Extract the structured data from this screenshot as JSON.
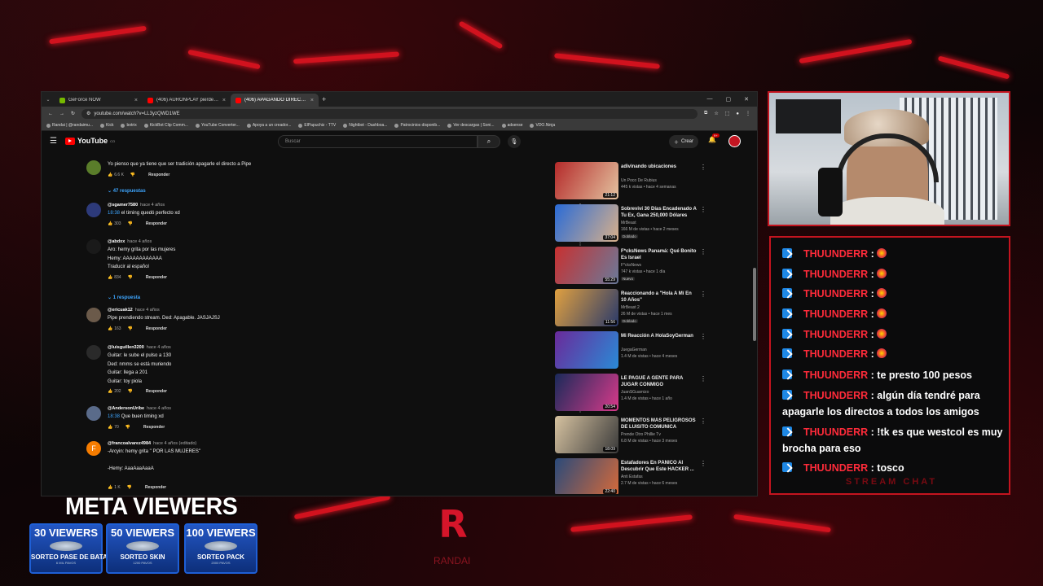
{
  "browser": {
    "tabs": [
      {
        "label": "GeForce NOW",
        "color": "#76b900",
        "active": false
      },
      {
        "label": "(406) AURONPLAY pierde MA",
        "color": "#ff0000",
        "active": false
      },
      {
        "label": "(406) APAGANDO DIRECTO",
        "color": "#ff0000",
        "active": true
      }
    ],
    "url": "youtube.com/watch?v=LL3yzQWD1WE",
    "bookmarks": [
      "Randai | @randaimu...",
      "Kick",
      "botrix",
      "KickBot Clip Comm...",
      "YouTube Converter...",
      "Apoya a un creador...",
      "ElPapuchiz - TTV",
      "Nightbot - Dashboa...",
      "Patrocinios disponib...",
      "Ver descargas | Soni...",
      "adsense",
      "VDO.Ninja"
    ]
  },
  "youtube": {
    "logo_text": "YouTube",
    "country": "CO",
    "search_placeholder": "Buscar",
    "create_label": "Crear",
    "notifications_badge": "9+"
  },
  "comments": [
    {
      "author": "",
      "meta": "",
      "text": "Yo pienso que ya tiene que ser tradición apagarle el directo a Pipe",
      "likes": "6.6 K",
      "reply": "Responder",
      "avatar_color": "#5a7d2a"
    },
    {
      "author": "@sgamer7580",
      "meta": "hace 4 años",
      "ts": "18:38",
      "text": "el timing quedó perfecto xd",
      "likes": "303",
      "reply": "Responder",
      "avatar_color": "#2d3a7a"
    },
    {
      "author": "@abdxx",
      "meta": "hace 4 años",
      "text": "Aro: hemy grita por las mujeres\nHemy: AAAAAAAAAAAA\nTraducir al español",
      "likes": "834",
      "reply": "Responder",
      "avatar_color": "#1a1a1a"
    },
    {
      "author": "@ericuak12",
      "meta": "hace 4 años",
      "text": "Pipe prendiendo stream. Ded: Apagable. JASJAJSJ",
      "likes": "163",
      "reply": "Responder",
      "avatar_color": "#6b5a4a"
    },
    {
      "author": "@luisguillen3200",
      "meta": "hace 4 años",
      "text": "Guitar: le sube el pulso a 130\nDed: nmms se está muriendo\nGuitar: llega a 201\nGuitar: toy piola",
      "likes": "202",
      "reply": "Responder",
      "avatar_color": "#2a2a2a"
    },
    {
      "author": "@AndersonUribe",
      "meta": "hace 4 años",
      "ts": "18:38",
      "text": "Que buen timing xd",
      "likes": "70",
      "reply": "Responder",
      "avatar_color": "#5a6b8a"
    },
    {
      "author": "@francoalvarez4984",
      "meta": "hace 4 años (editado)",
      "text": "-Arcyin: hemy grita \" POR LAS MUJERES\"\n\n-Hemy: AaaAaaAaaA",
      "likes": "1 K",
      "reply": "Responder",
      "avatar_color": "#f57c00",
      "avatar_letter": "F"
    }
  ],
  "replies": [
    "47 respuestas",
    "1 respuesta"
  ],
  "related": [
    {
      "title": "adivinando ubicaciones",
      "channel": "Un Poco De Rubius",
      "meta": "445 k vistas • hace 4 semanas",
      "duration": "21:12",
      "badge": "",
      "c1": "#b52a2a",
      "c2": "#e3c3a0"
    },
    {
      "title": "Sobreviví 30 Días Encadenado A Tu Ex, Gana 250,000 Dólares",
      "channel": "MrBeast",
      "meta": "166 M de vistas • hace 2 meses",
      "duration": "37:04",
      "badge": "Doblado",
      "c1": "#2a6bd6",
      "c2": "#d8b08a"
    },
    {
      "title": "F*cksNews Panamá: Qué Bonito Es Israel",
      "channel": "F*cksNews",
      "meta": "747 k vistas • hace 1 día",
      "duration": "55:29",
      "badge": "Nuevo",
      "c1": "#c83030",
      "c2": "#6a7a9a"
    },
    {
      "title": "Reaccionando a \"Hola A Mí En 10 Años\"",
      "channel": "MrBeast 2",
      "meta": "26 M de vistas • hace 1 mes",
      "duration": "11:56",
      "badge": "Doblado",
      "c1": "#e0a040",
      "c2": "#2a3a6a"
    },
    {
      "title": "Mi Reacción A HolaSoyGerman",
      "channel": "JuegaGerman",
      "meta": "1.4 M de vistas • hace 4 meses",
      "duration": "",
      "badge": "",
      "c1": "#6a2a9a",
      "c2": "#2a8ad6"
    },
    {
      "title": "LE PAGUÉ A GENTE PARA JUGAR CONMIGO",
      "channel": "JuanSGuarnizo",
      "meta": "1.4 M de vistas • hace 1 año",
      "duration": "20:54",
      "badge": "",
      "c1": "#1a2a5a",
      "c2": "#d83a8a"
    },
    {
      "title": "MOMENTOS MÁS PELIGROSOS DE LUISITO COMUNICA",
      "channel": "Prende Otro Phillie Tv",
      "meta": "6.8 M de vistas • hace 3 meses",
      "duration": "18:09",
      "badge": "",
      "c1": "#d6c2a0",
      "c2": "#3a3a3a"
    },
    {
      "title": "Estafadores En PÁNICO Al Descubrir Que Este HACKER ...",
      "channel": "Anti Estafas",
      "meta": "2.7 M de vistas • hace 6 meses",
      "duration": "22:40",
      "badge": "",
      "c1": "#2a4a7a",
      "c2": "#d66a3a"
    }
  ],
  "chat": {
    "messages": [
      {
        "user": "THUUNDERR",
        "text": "",
        "emote": true
      },
      {
        "user": "THUUNDERR",
        "text": "",
        "emote": true
      },
      {
        "user": "THUUNDERR",
        "text": "",
        "emote": true
      },
      {
        "user": "THUUNDERR",
        "text": "",
        "emote": true
      },
      {
        "user": "THUUNDERR",
        "text": "",
        "emote": true
      },
      {
        "user": "THUUNDERR",
        "text": "",
        "emote": true
      },
      {
        "user": "THUUNDERR",
        "text": "te presto 100 pesos",
        "emote": false
      },
      {
        "user": "THUUNDERR",
        "text": "algún día tendré para apagarle los directos a todos los amigos",
        "emote": false
      },
      {
        "user": "THUUNDERR",
        "text": "!tk es que westcol es muy brocha para eso",
        "emote": false
      },
      {
        "user": "THUUNDERR",
        "text": "tosco",
        "emote": false
      }
    ],
    "footer": "STREAM CHAT"
  },
  "overlay": {
    "meta_title": "META VIEWERS",
    "goals": [
      {
        "title": "30 VIEWERS",
        "reward": "SORTEO PASE DE BATALLA",
        "note": "6 MIL PAVOS"
      },
      {
        "title": "50 VIEWERS",
        "reward": "SORTEO SKIN",
        "note": "1200 PAVOS"
      },
      {
        "title": "100 VIEWERS",
        "reward": "SORTEO PACK",
        "note": "2000 PAVOS"
      }
    ],
    "logo_text": "RANDAI"
  }
}
